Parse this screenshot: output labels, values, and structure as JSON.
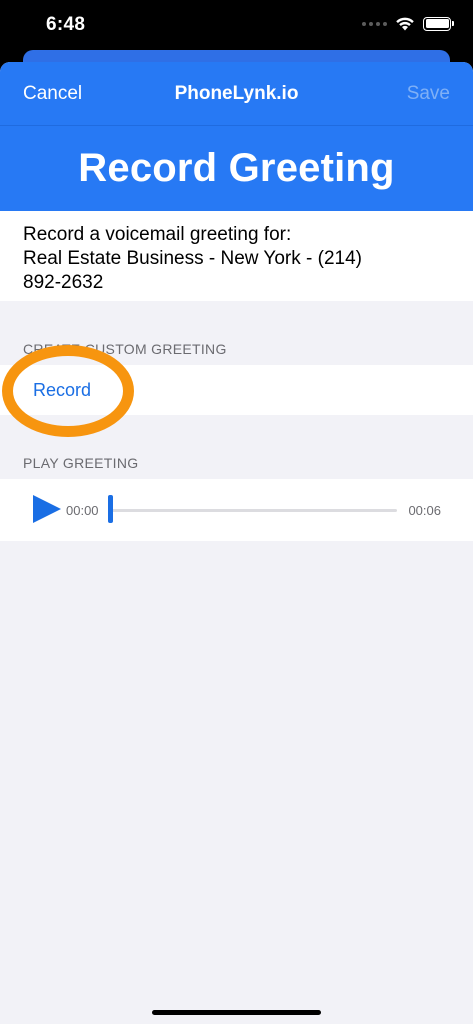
{
  "status_bar": {
    "time": "6:48",
    "icons": [
      "cellular-dots-icon",
      "wifi-icon",
      "battery-icon"
    ]
  },
  "nav": {
    "cancel_label": "Cancel",
    "title": "PhoneLynk.io",
    "save_label": "Save",
    "save_enabled": false
  },
  "header": {
    "title": "Record Greeting"
  },
  "description": {
    "line1": "Record a voicemail greeting for:",
    "line2": "Real Estate Business - New York - (214)",
    "line3": "892-2632"
  },
  "create_section": {
    "header": "CREATE CUSTOM GREETING",
    "record_label": "Record"
  },
  "play_section": {
    "header": "PLAY GREETING",
    "current_time": "00:00",
    "total_time": "00:06",
    "progress": 0
  },
  "colors": {
    "brand_blue": "#2779f4",
    "link_blue": "#1a6ee4",
    "highlight_orange": "#f7950f",
    "grouped_background": "#f2f2f7"
  }
}
